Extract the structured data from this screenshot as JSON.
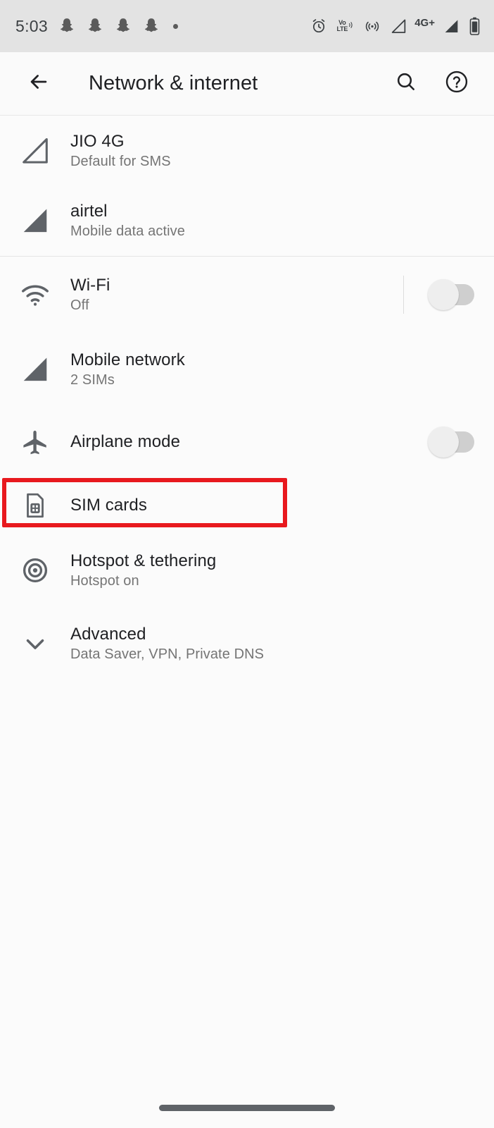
{
  "status_bar": {
    "clock": "5:03",
    "notification_icons": [
      "snapchat-ghost-icon",
      "snapchat-ghost-icon",
      "snapchat-ghost-icon",
      "snapchat-ghost-icon",
      "overflow-dot-icon"
    ],
    "system_icons": [
      "alarm-icon",
      "volte-icon",
      "hotspot-icon",
      "sim1-signal-icon",
      "network-type-label",
      "sim2-signal-icon",
      "battery-icon"
    ],
    "volte_top": "Vo",
    "volte_bottom": "LTE",
    "network_type": "4G+"
  },
  "app_bar": {
    "back_icon": "back-arrow-icon",
    "title": "Network & internet",
    "search_icon": "search-icon",
    "help_icon": "help-icon"
  },
  "sim_group": [
    {
      "icon": "signal-outline-icon",
      "title": "JIO 4G",
      "subtitle": "Default for SMS"
    },
    {
      "icon": "signal-filled-icon",
      "title": "airtel",
      "subtitle": "Mobile data active"
    }
  ],
  "settings_items": [
    {
      "icon": "wifi-icon",
      "title": "Wi-Fi",
      "subtitle": "Off",
      "toggle": "off",
      "divider": true
    },
    {
      "icon": "signal-filled-icon",
      "title": "Mobile network",
      "subtitle": "2 SIMs",
      "toggle": null,
      "divider": false
    },
    {
      "icon": "airplane-icon",
      "title": "Airplane mode",
      "subtitle": "",
      "toggle": "off",
      "divider": false
    },
    {
      "icon": "sim-card-icon",
      "title": "SIM cards",
      "subtitle": "",
      "toggle": null,
      "divider": false
    },
    {
      "icon": "hotspot-icon",
      "title": "Hotspot & tethering",
      "subtitle": "Hotspot on",
      "toggle": null,
      "divider": false
    },
    {
      "icon": "chevron-down-icon",
      "title": "Advanced",
      "subtitle": "Data Saver, VPN, Private DNS",
      "toggle": null,
      "divider": false
    }
  ],
  "highlight": {
    "target": "SIM cards",
    "color": "#e8191e"
  },
  "nav_bar": {
    "pill": "gesture-nav-pill"
  }
}
